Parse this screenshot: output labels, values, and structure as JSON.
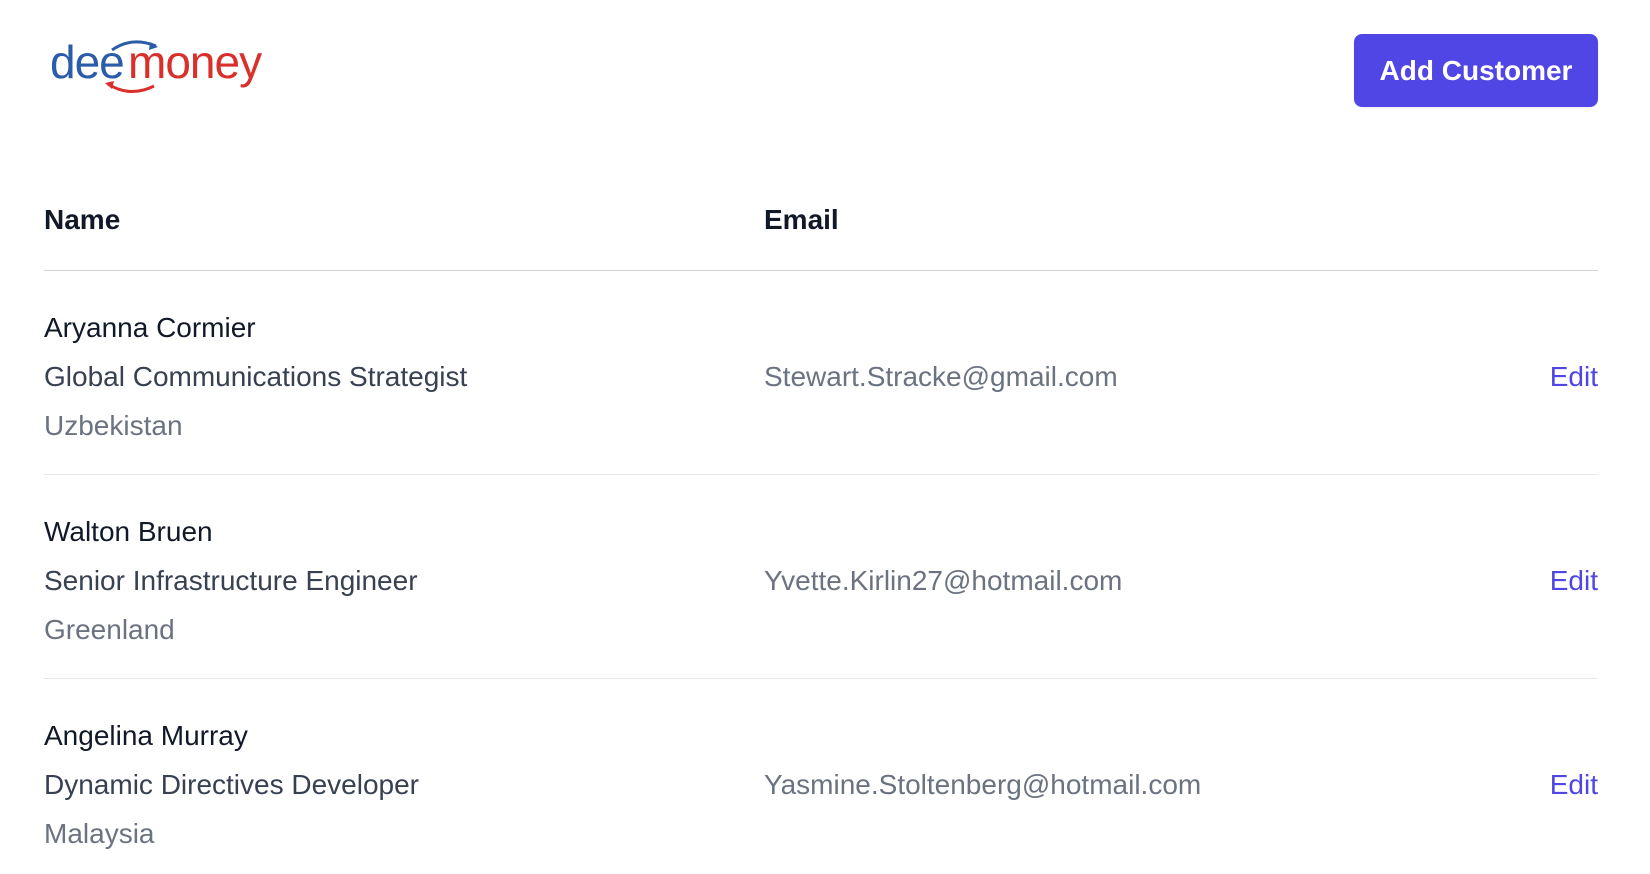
{
  "brand": {
    "logo_text_part1": "dee",
    "logo_text_part2": "money",
    "color_blue": "#2a5caa",
    "color_red": "#d9302c"
  },
  "header": {
    "add_button_label": "Add Customer"
  },
  "table": {
    "columns": [
      "Name",
      "Email"
    ],
    "action_label": "Edit",
    "rows": [
      {
        "name": "Aryanna Cormier",
        "role": "Global Communications Strategist",
        "country": "Uzbekistan",
        "email": "Stewart.Stracke@gmail.com"
      },
      {
        "name": "Walton Bruen",
        "role": "Senior Infrastructure Engineer",
        "country": "Greenland",
        "email": "Yvette.Kirlin27@hotmail.com"
      },
      {
        "name": "Angelina Murray",
        "role": "Dynamic Directives Developer",
        "country": "Malaysia",
        "email": "Yasmine.Stoltenberg@hotmail.com"
      }
    ]
  },
  "colors": {
    "accent": "#4f46e5",
    "heading_text": "#111827",
    "muted_text": "#6b7280"
  }
}
